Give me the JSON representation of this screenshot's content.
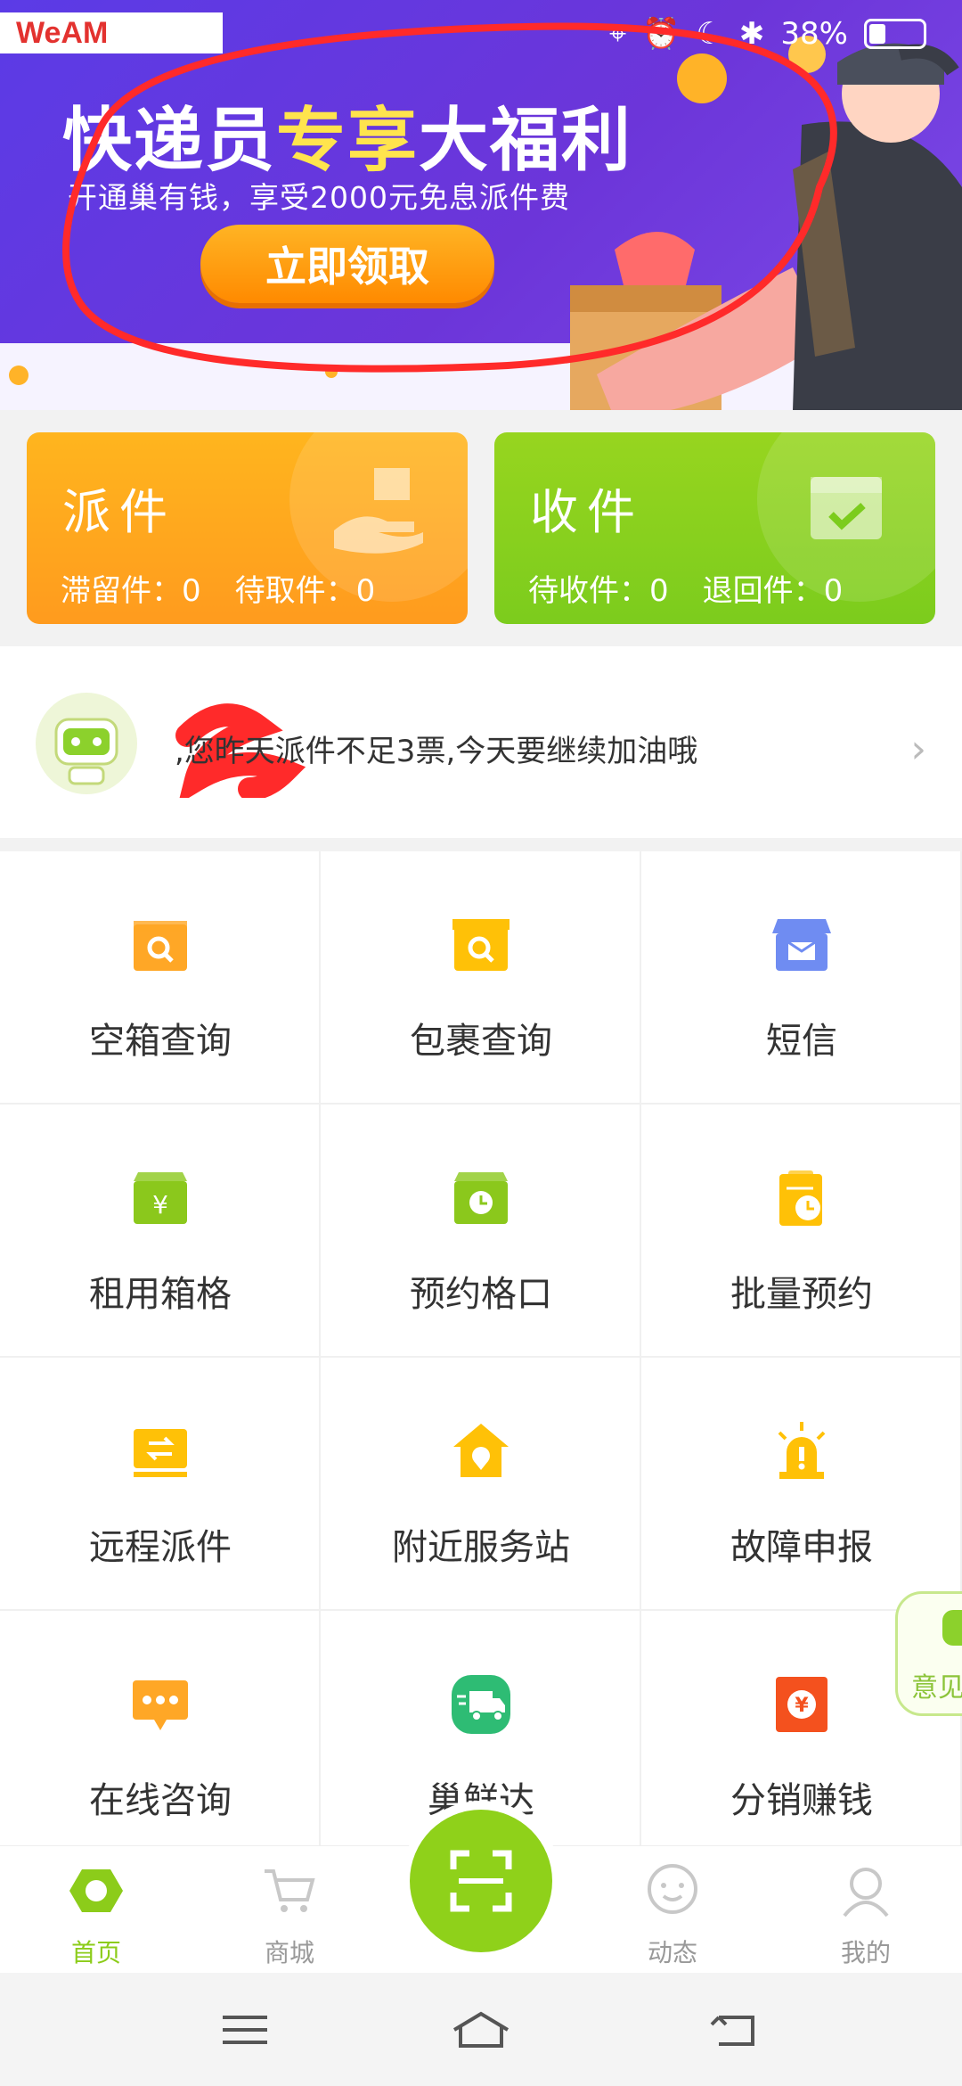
{
  "status_bar": {
    "carrier_logo": "WeAM",
    "battery": "38%"
  },
  "banner": {
    "title_prefix": "快递员",
    "title_highlight": "专享",
    "title_suffix": "大福利",
    "subtitle": "开通巢有钱，享受2000元免息派件费",
    "cta": "立即领取"
  },
  "cards": {
    "paijian": {
      "title": "派件",
      "stat1_label": "滞留件：",
      "stat1_value": "0",
      "stat2_label": "待取件：",
      "stat2_value": "0"
    },
    "shoujian": {
      "title": "收件",
      "stat1_label": "待收件：",
      "stat1_value": "0",
      "stat2_label": "退回件：",
      "stat2_value": "0"
    }
  },
  "notice": {
    "text": ",您昨天派件不足3票,今天要继续加油哦"
  },
  "grid": [
    {
      "label": "空箱查询",
      "icon": "box-search-icon",
      "color": "#ffa726"
    },
    {
      "label": "包裹查询",
      "icon": "package-search-icon",
      "color": "#ffc107"
    },
    {
      "label": "短信",
      "icon": "sms-icon",
      "color": "#6f8cf2"
    },
    {
      "label": "租用箱格",
      "icon": "box-rent-icon",
      "color": "#8bc81c"
    },
    {
      "label": "预约格口",
      "icon": "box-reserve-icon",
      "color": "#8bc81c"
    },
    {
      "label": "批量预约",
      "icon": "batch-reserve-icon",
      "color": "#ffc107"
    },
    {
      "label": "远程派件",
      "icon": "remote-delivery-icon",
      "color": "#ffc107"
    },
    {
      "label": "附近服务站",
      "icon": "nearby-station-icon",
      "color": "#ffc107"
    },
    {
      "label": "故障申报",
      "icon": "alarm-icon",
      "color": "#ffc107"
    },
    {
      "label": "在线咨询",
      "icon": "chat-icon",
      "color": "#ffa726"
    },
    {
      "label": "巢鲜达",
      "icon": "truck-icon",
      "color": "#2ebc74"
    },
    {
      "label": "分销赚钱",
      "icon": "yuan-icon",
      "color": "#f4511e"
    }
  ],
  "feedback": {
    "label": "意见"
  },
  "tabs": [
    {
      "label": "首页"
    },
    {
      "label": "商城"
    },
    {
      "label": "动态"
    },
    {
      "label": "我的"
    }
  ]
}
